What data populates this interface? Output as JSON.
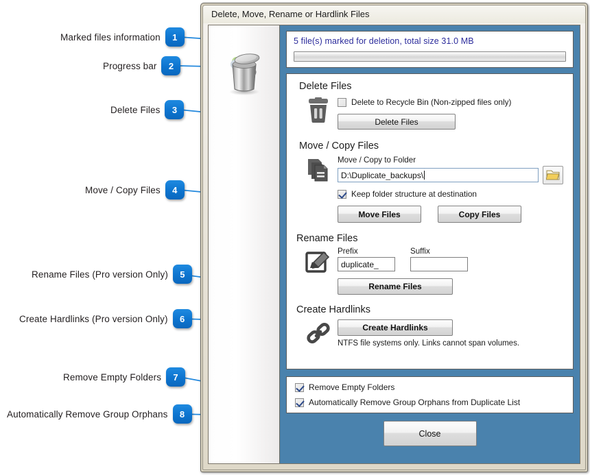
{
  "window": {
    "title": "Delete, Move, Rename or Hardlink Files"
  },
  "status": {
    "marked_files_text": "5 file(s) marked for deletion, total size 31.0 MB",
    "progress_percent": 0,
    "text_color": "#2c2c9c"
  },
  "sections": {
    "delete": {
      "title": "Delete Files",
      "recycle_checkbox_label": "Delete to Recycle Bin (Non-zipped files only)",
      "recycle_checked": false,
      "button_label": "Delete Files"
    },
    "move_copy": {
      "title": "Move / Copy Files",
      "folder_label": "Move / Copy to Folder",
      "folder_value": "D:\\Duplicate_backups\\",
      "keep_structure_label": "Keep folder structure at destination",
      "keep_structure_checked": true,
      "move_button_label": "Move Files",
      "copy_button_label": "Copy Files"
    },
    "rename": {
      "title": "Rename Files",
      "prefix_label": "Prefix",
      "prefix_value": "duplicate_",
      "suffix_label": "Suffix",
      "suffix_value": "",
      "button_label": "Rename Files"
    },
    "hardlinks": {
      "title": "Create Hardlinks",
      "button_label": "Create Hardlinks",
      "note": "NTFS file systems only.  Links cannot span volumes."
    }
  },
  "options": {
    "remove_empty_folders_label": "Remove Empty Folders",
    "remove_empty_folders_checked": true,
    "remove_orphans_label": "Automatically Remove Group Orphans from Duplicate List",
    "remove_orphans_checked": true
  },
  "footer": {
    "close_label": "Close"
  },
  "callouts": [
    {
      "number": "1",
      "label": "Marked files information"
    },
    {
      "number": "2",
      "label": "Progress bar"
    },
    {
      "number": "3",
      "label": "Delete Files"
    },
    {
      "number": "4",
      "label": "Move / Copy Files"
    },
    {
      "number": "5",
      "label": "Rename Files (Pro version Only)"
    },
    {
      "number": "6",
      "label": "Create Hardlinks (Pro version Only)"
    },
    {
      "number": "7",
      "label": "Remove Empty Folders"
    },
    {
      "number": "8",
      "label": "Automatically Remove Group Orphans"
    }
  ],
  "colors": {
    "accent_blue": "#0d74cf",
    "panel_blue": "#4a82ad",
    "leader_line": "#2288dd"
  }
}
